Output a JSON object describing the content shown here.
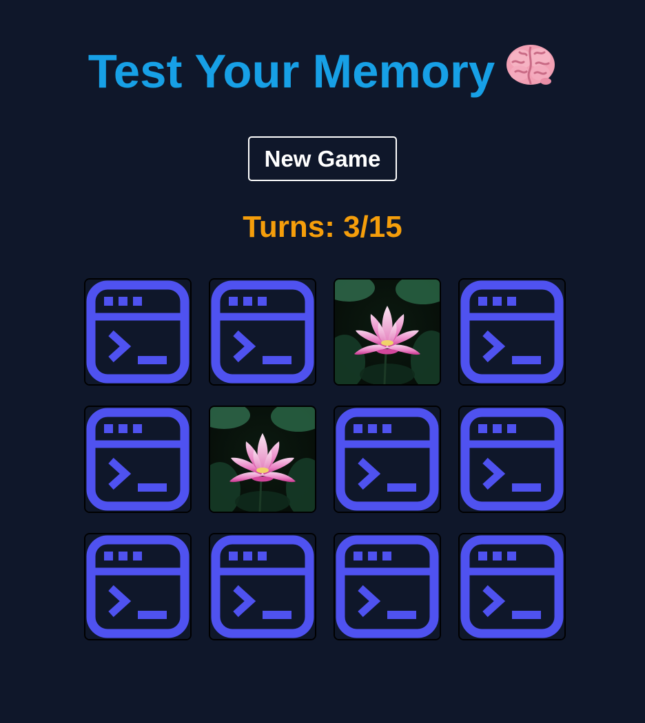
{
  "header": {
    "title": "Test Your Memory",
    "title_icon": "brain-icon"
  },
  "controls": {
    "new_game_label": "New Game"
  },
  "status": {
    "turns_text": "Turns: 3/15",
    "turns_used": 3,
    "turns_max": 15
  },
  "board": {
    "rows": 3,
    "columns": 4,
    "card_back_icon": "terminal-window-icon",
    "cards": [
      {
        "state": "face-down",
        "face": "terminal-window-icon"
      },
      {
        "state": "face-down",
        "face": "terminal-window-icon"
      },
      {
        "state": "face-up",
        "face": "lotus-flower"
      },
      {
        "state": "face-down",
        "face": "terminal-window-icon"
      },
      {
        "state": "face-down",
        "face": "terminal-window-icon"
      },
      {
        "state": "face-up",
        "face": "lotus-flower"
      },
      {
        "state": "face-down",
        "face": "terminal-window-icon"
      },
      {
        "state": "face-down",
        "face": "terminal-window-icon"
      },
      {
        "state": "face-down",
        "face": "terminal-window-icon"
      },
      {
        "state": "face-down",
        "face": "terminal-window-icon"
      },
      {
        "state": "face-down",
        "face": "terminal-window-icon"
      },
      {
        "state": "face-down",
        "face": "terminal-window-icon"
      }
    ]
  },
  "colors": {
    "background": "#0f172a",
    "title": "#17a0e6",
    "turns": "#f59e0b",
    "card_back": "#4f52f0",
    "button_border": "#ffffff"
  }
}
